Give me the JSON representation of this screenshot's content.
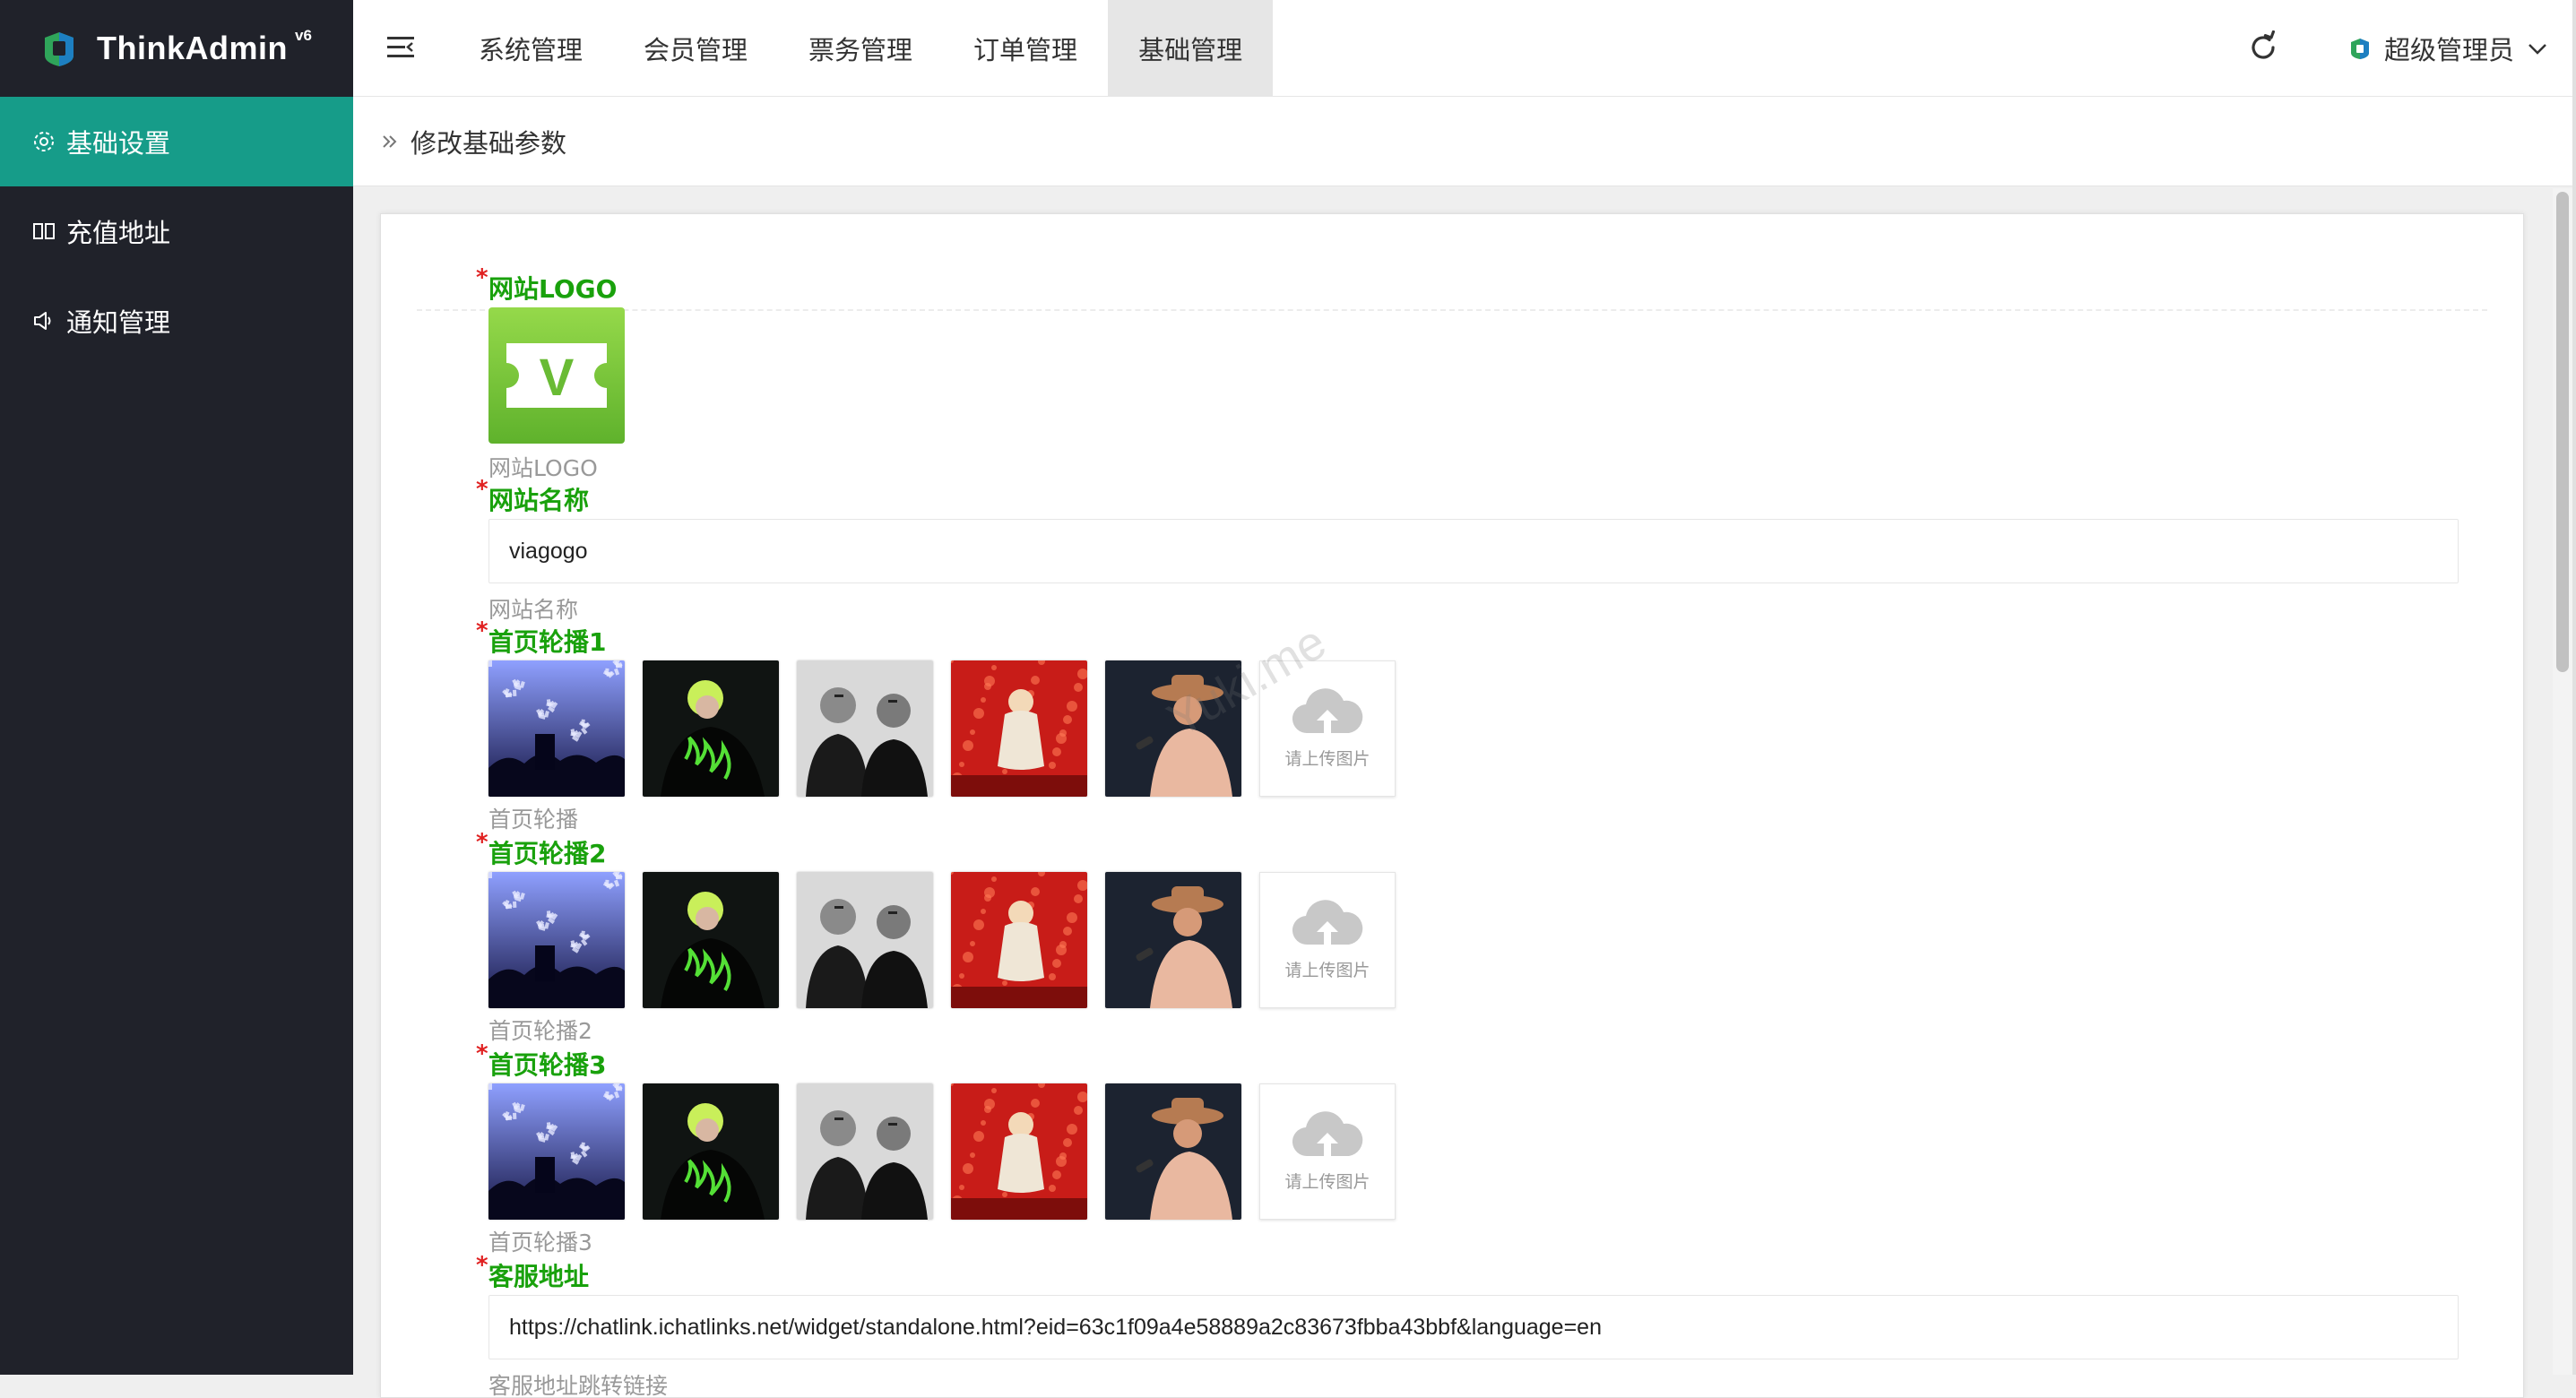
{
  "app": {
    "name": "ThinkAdmin",
    "version": "v6"
  },
  "sidebar": {
    "items": [
      {
        "label": "基础设置",
        "icon": "gear-icon",
        "active": true
      },
      {
        "label": "充值地址",
        "icon": "columns-icon",
        "active": false
      },
      {
        "label": "通知管理",
        "icon": "speaker-icon",
        "active": false
      }
    ]
  },
  "topnav": {
    "items": [
      {
        "label": "系统管理",
        "active": false
      },
      {
        "label": "会员管理",
        "active": false
      },
      {
        "label": "票务管理",
        "active": false
      },
      {
        "label": "订单管理",
        "active": false
      },
      {
        "label": "基础管理",
        "active": true
      }
    ]
  },
  "user": {
    "name": "超级管理员"
  },
  "breadcrumb": {
    "title": "修改基础参数"
  },
  "form": {
    "logo": {
      "label": "网站LOGO",
      "help": "网站LOGO",
      "logo_letter": "V"
    },
    "site_name": {
      "label": "网站名称",
      "value": "viagogo",
      "help": "网站名称"
    },
    "banners": [
      {
        "label": "首页轮播1",
        "help": "首页轮播",
        "upload_text": "请上传图片"
      },
      {
        "label": "首页轮播2",
        "help": "首页轮播2",
        "upload_text": "请上传图片"
      },
      {
        "label": "首页轮播3",
        "help": "首页轮播3",
        "upload_text": "请上传图片"
      }
    ],
    "service_url": {
      "label": "客服地址",
      "value": "https://chatlink.ichatlinks.net/widget/standalone.html?eid=63c1f09a4e58889a2c83673fbba43bbf&language=en",
      "help": "客服地址跳转链接"
    }
  },
  "watermark": "Yuki.me",
  "colors": {
    "sidebar_bg": "#20222a",
    "accent": "#169c89",
    "label_green": "#19a10c",
    "required_red": "#e02020"
  }
}
